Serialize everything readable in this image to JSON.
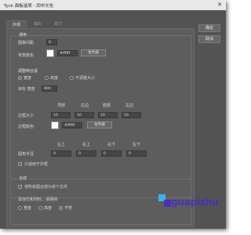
{
  "window": {
    "title": "Tyck 面板选项 - 同中文化",
    "close_glyph": "✕"
  },
  "tabs": [
    {
      "label": "外观"
    },
    {
      "label": "输出"
    },
    {
      "label": "其它"
    }
  ],
  "buttons": {
    "ok": "确定",
    "cancel": "取消"
  },
  "general": {
    "header": "通用",
    "margin_label": "图像间距",
    "margin_value": "8",
    "bg_label": "背景颜色",
    "bg_hex": "#ffffff",
    "bg_picker": "拾色器",
    "bg_color": "#ffffff"
  },
  "resize": {
    "header": "调整到合适",
    "options": [
      {
        "label": "宽度",
        "selected": true
      },
      {
        "label": "高度",
        "selected": false
      },
      {
        "label": "不调整大小",
        "selected": false
      }
    ],
    "target_label": "目标 宽度",
    "target_value": "800"
  },
  "borders": {
    "col_headers": [
      "顶部",
      "右边",
      "底部",
      "左边"
    ],
    "size_label": "边框大小",
    "size_values": [
      "10",
      "10",
      "10",
      "10"
    ],
    "color_label": "边框颜色",
    "color_hex": "#ffffff",
    "color_picker": "拾色器",
    "color": "#ffffff"
  },
  "corners": {
    "col_headers": [
      "左上",
      "右上",
      "右下",
      "左下"
    ],
    "radius_label": "圆角半径",
    "radius_values": [
      "0",
      "0",
      "0",
      "0"
    ],
    "outer_only_label": "只适用于外框",
    "outer_only_checked": true
  },
  "combine": {
    "header": "合成",
    "single_file_label": "将所有图合成为单个文件",
    "single_file_checked": true,
    "pref_label": "添加行和列时，请保持:",
    "options": [
      {
        "label": "宽度",
        "selected": false
      },
      {
        "label": "高度",
        "selected": false
      },
      {
        "label": "不管",
        "selected": true
      }
    ]
  },
  "watermark": {
    "text": "guapizhu",
    "colors": [
      "#3bb3e8",
      "#4a2fb8"
    ]
  }
}
